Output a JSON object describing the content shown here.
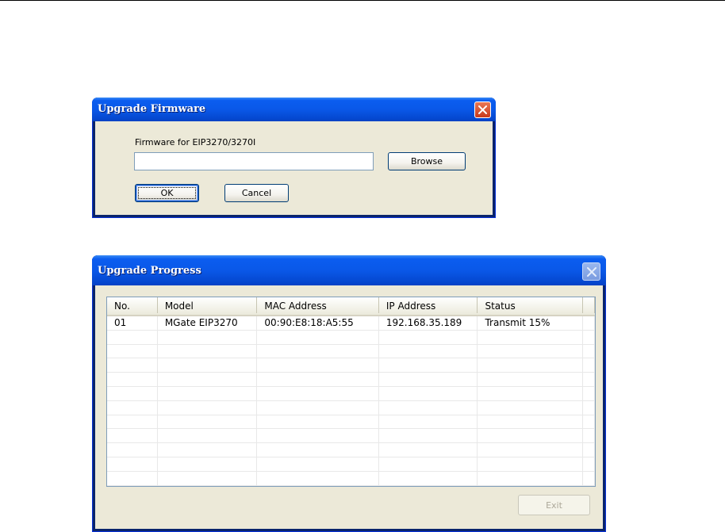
{
  "firmware_dialog": {
    "title": "Upgrade Firmware",
    "firmware_label": "Firmware for EIP3270/3270I",
    "firmware_path_value": "",
    "browse_label": "Browse",
    "ok_label": "OK",
    "cancel_label": "Cancel"
  },
  "progress_dialog": {
    "title": "Upgrade Progress",
    "columns": [
      "No.",
      "Model",
      "MAC Address",
      "IP Address",
      "Status"
    ],
    "rows": [
      {
        "no": "01",
        "model": "MGate EIP3270",
        "mac": "00:90:E8:18:A5:55",
        "ip": "192.168.35.189",
        "status": "Transmit 15%"
      }
    ],
    "exit_label": "Exit"
  },
  "icons": {
    "close": "close-icon"
  }
}
